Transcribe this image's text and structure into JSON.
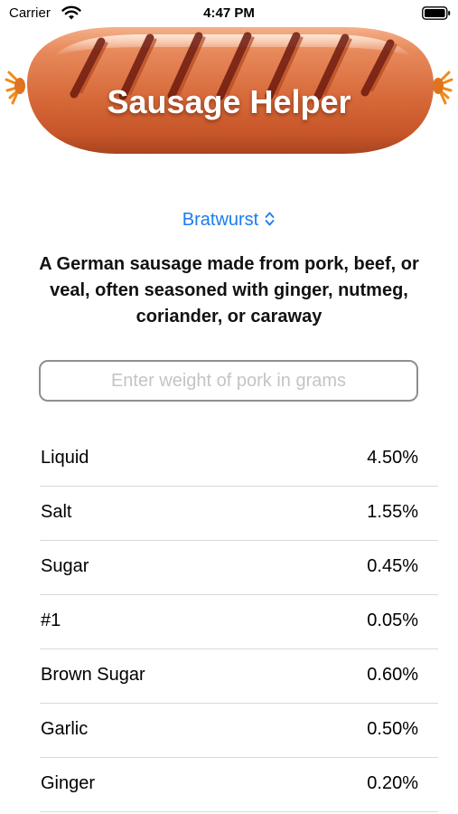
{
  "status_bar": {
    "carrier": "Carrier",
    "time": "4:47 PM",
    "wifi_icon": "wifi-icon",
    "battery_icon": "battery-icon"
  },
  "header": {
    "title": "Sausage Helper",
    "image": "sausage-image"
  },
  "picker": {
    "selected": "Bratwurst",
    "icon": "chevron-up-down-icon",
    "color": "#1a7cf0"
  },
  "description": "A German sausage made from pork, beef, or veal, often seasoned with ginger, nutmeg, coriander, or caraway",
  "weight_input": {
    "placeholder": "Enter weight of pork in grams",
    "value": ""
  },
  "ingredients": [
    {
      "name": "Liquid",
      "percent": "4.50%"
    },
    {
      "name": "Salt",
      "percent": "1.55%"
    },
    {
      "name": "Sugar",
      "percent": "0.45%"
    },
    {
      "name": "#1",
      "percent": "0.05%"
    },
    {
      "name": "Brown Sugar",
      "percent": "0.60%"
    },
    {
      "name": "Garlic",
      "percent": "0.50%"
    },
    {
      "name": "Ginger",
      "percent": "0.20%"
    }
  ]
}
